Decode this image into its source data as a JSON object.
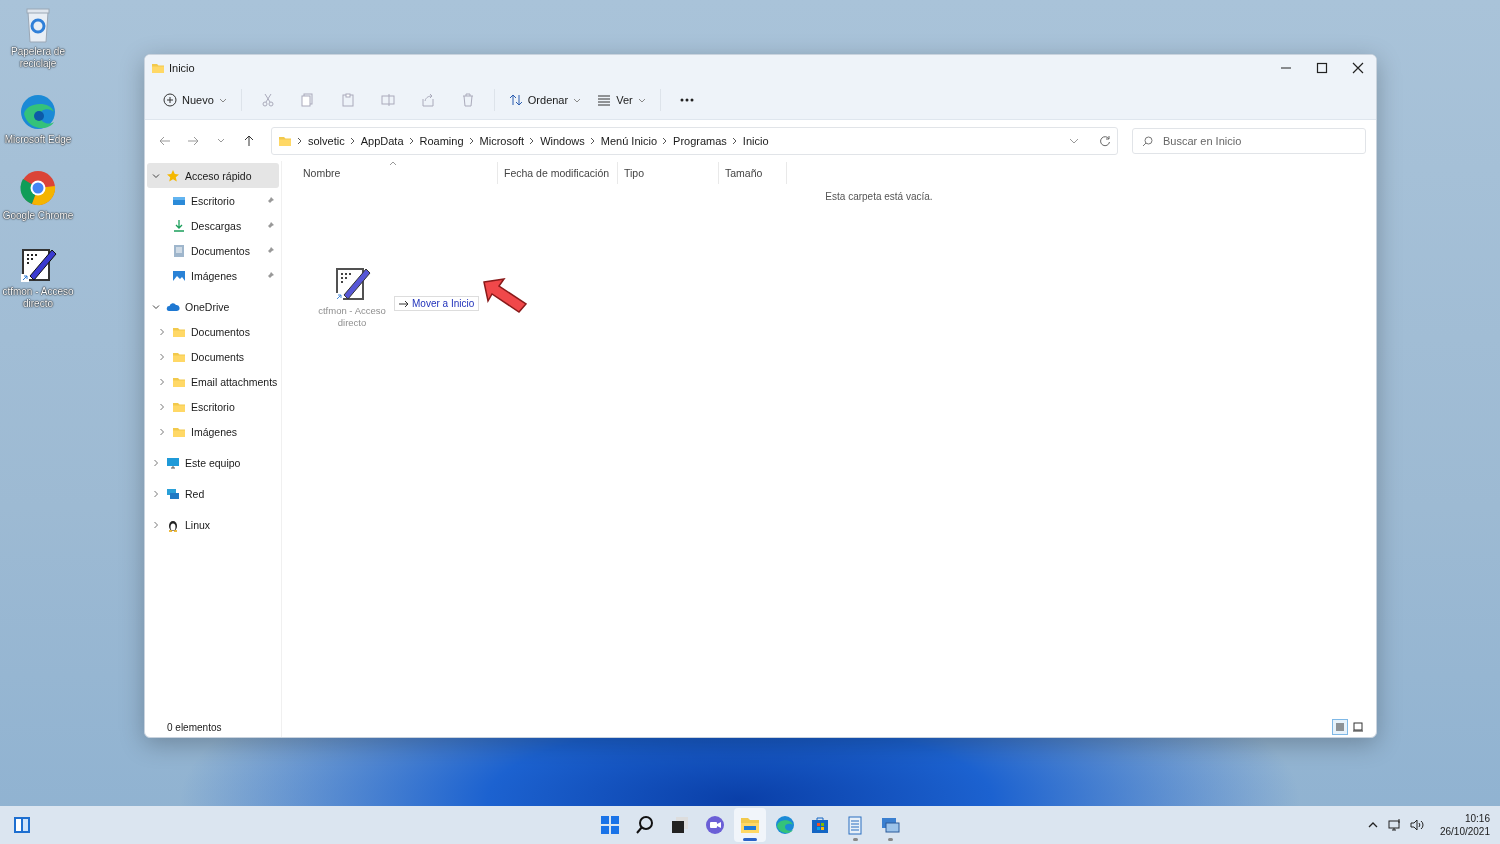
{
  "desktop_icons": [
    {
      "kind": "recycle",
      "label": "Papelera de reciclaje"
    },
    {
      "kind": "edge",
      "label": "Microsoft Edge"
    },
    {
      "kind": "chrome",
      "label": "Google Chrome"
    },
    {
      "kind": "ctfmon",
      "label": "ctfmon - Acceso directo"
    }
  ],
  "window": {
    "title": "Inicio"
  },
  "toolbar": {
    "new_label": "Nuevo",
    "sort_label": "Ordenar",
    "view_label": "Ver"
  },
  "address": {
    "path": [
      "solvetic",
      "AppData",
      "Roaming",
      "Microsoft",
      "Windows",
      "Menú Inicio",
      "Programas",
      "Inicio"
    ],
    "search_placeholder": "Buscar en Inicio"
  },
  "sidebar": [
    {
      "kind": "star",
      "label": "Acceso rápido",
      "expanded": true,
      "selected": true,
      "children": [
        {
          "kind": "desktop",
          "label": "Escritorio",
          "pinned": true,
          "selected": false
        },
        {
          "kind": "download",
          "label": "Descargas",
          "pinned": true,
          "selected": false
        },
        {
          "kind": "document",
          "label": "Documentos",
          "pinned": true,
          "selected": false
        },
        {
          "kind": "picture",
          "label": "Imágenes",
          "pinned": true,
          "selected": false
        }
      ]
    },
    {
      "kind": "cloud",
      "label": "OneDrive",
      "expanded": true,
      "selected": false,
      "children": [
        {
          "kind": "folder",
          "label": "Documentos",
          "expanded": false,
          "selected": false
        },
        {
          "kind": "folder",
          "label": "Documents",
          "expanded": false,
          "selected": false
        },
        {
          "kind": "folder",
          "label": "Email attachments",
          "expanded": false,
          "selected": false
        },
        {
          "kind": "folder",
          "label": "Escritorio",
          "expanded": false,
          "selected": false
        },
        {
          "kind": "folder",
          "label": "Imágenes",
          "expanded": false,
          "selected": false
        }
      ]
    },
    {
      "kind": "pc",
      "label": "Este equipo",
      "expanded": false,
      "selected": false
    },
    {
      "kind": "network",
      "label": "Red",
      "expanded": false,
      "selected": false
    },
    {
      "kind": "linux",
      "label": "Linux",
      "expanded": false,
      "selected": false
    }
  ],
  "columns": [
    {
      "label": "Nombre",
      "sorted": true
    },
    {
      "label": "Fecha de modificación"
    },
    {
      "label": "Tipo"
    },
    {
      "label": "Tamaño"
    }
  ],
  "empty_message": "Esta carpeta está vacía.",
  "drag": {
    "file_label": "ctfmon - Acceso directo",
    "tooltip": "Mover a Inicio"
  },
  "status_bar": {
    "count": "0 elementos",
    "views": [
      {
        "kind": "details",
        "selected": true
      },
      {
        "kind": "tiles",
        "selected": false
      }
    ]
  },
  "taskbar": {
    "apps": [
      {
        "kind": "start",
        "running": false,
        "active": false
      },
      {
        "kind": "search",
        "running": false,
        "active": false
      },
      {
        "kind": "taskview",
        "running": false,
        "active": false
      },
      {
        "kind": "chat",
        "running": false,
        "active": false
      },
      {
        "kind": "explorer",
        "running": true,
        "active": true
      },
      {
        "kind": "edge",
        "running": false,
        "active": false
      },
      {
        "kind": "store",
        "running": false,
        "active": false
      },
      {
        "kind": "notepad",
        "running": true,
        "active": false
      },
      {
        "kind": "remote",
        "running": true,
        "active": false
      }
    ],
    "clock": {
      "time": "10:16",
      "date": "26/10/2021"
    }
  }
}
